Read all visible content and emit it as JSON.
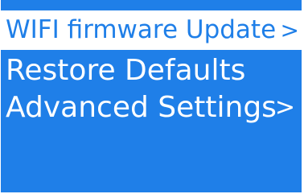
{
  "colors": {
    "panel_background": "#1f7fe8",
    "selected_background": "#ffffff",
    "text": "#ffffff",
    "selected_text": "#1f7fe8"
  },
  "menu": {
    "items": [
      {
        "label": "WIFI firmware Update",
        "icon": "chevron-right-icon",
        "glyph": ">"
      },
      {
        "label": "Restore Defaults"
      },
      {
        "label": "Advanced Settings",
        "icon": "chevron-right-icon",
        "glyph": ">"
      }
    ]
  }
}
